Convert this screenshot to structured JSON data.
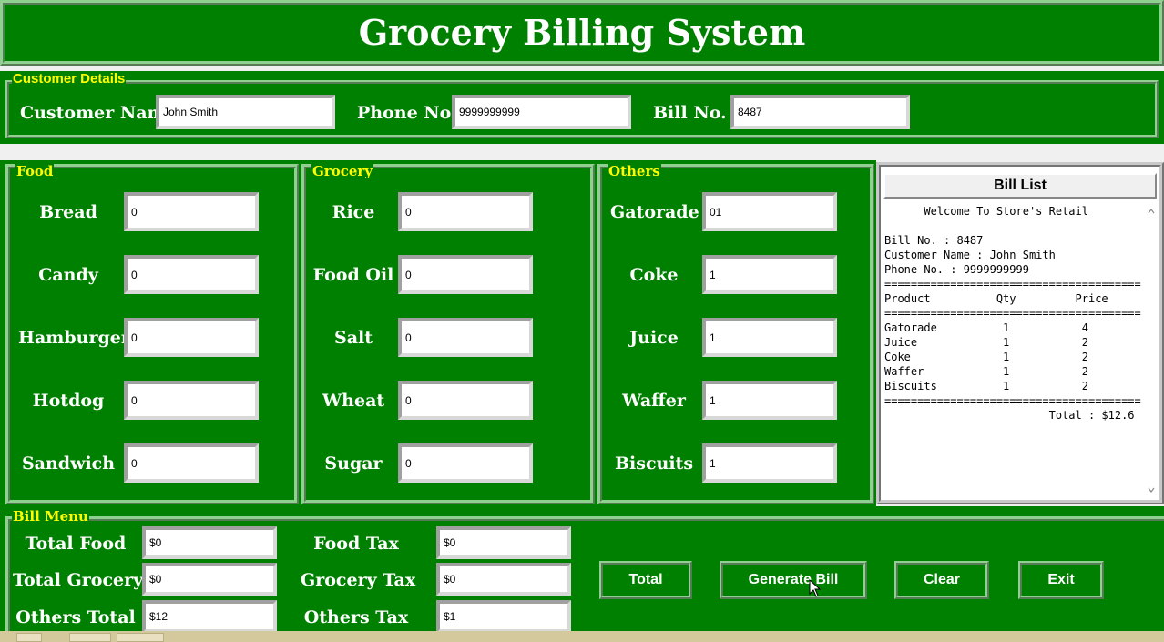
{
  "window": {
    "title": "Grocery Billing System"
  },
  "customer": {
    "frame_label": "Customer Details",
    "name_label": "Customer Name",
    "name_value": "John Smith",
    "phone_label": "Phone No",
    "phone_value": "9999999999",
    "bill_label": "Bill No.",
    "bill_value": "8487"
  },
  "food": {
    "frame_label": "Food",
    "items": [
      {
        "label": "Bread",
        "value": "0"
      },
      {
        "label": "Candy",
        "value": "0"
      },
      {
        "label": "Hamburger",
        "value": "0"
      },
      {
        "label": "Hotdog",
        "value": "0"
      },
      {
        "label": "Sandwich",
        "value": "0"
      }
    ]
  },
  "grocery": {
    "frame_label": "Grocery",
    "items": [
      {
        "label": "Rice",
        "value": "0"
      },
      {
        "label": "Food Oil",
        "value": "0"
      },
      {
        "label": "Salt",
        "value": "0"
      },
      {
        "label": "Wheat",
        "value": "0"
      },
      {
        "label": "Sugar",
        "value": "0"
      }
    ]
  },
  "others": {
    "frame_label": "Others",
    "items": [
      {
        "label": "Gatorade",
        "value": "01"
      },
      {
        "label": "Coke",
        "value": "1"
      },
      {
        "label": "Juice",
        "value": "1"
      },
      {
        "label": "Waffer",
        "value": "1"
      },
      {
        "label": "Biscuits",
        "value": "1"
      }
    ]
  },
  "bill": {
    "title": "Bill List",
    "lines": [
      "      Welcome To Store's Retail",
      "",
      "Bill No. : 8487",
      "Customer Name : John Smith",
      "Phone No. : 9999999999",
      "=======================================",
      "Product          Qty         Price",
      "=======================================",
      "Gatorade          1           4",
      "Juice             1           2",
      "Coke              1           2",
      "Waffer            1           2",
      "Biscuits          1           2",
      "=======================================",
      "                         Total : $12.6"
    ]
  },
  "bill_menu": {
    "frame_label": "Bill Menu",
    "total_food_label": "Total Food",
    "total_food_value": "$0",
    "total_grocery_label": "Total Grocery",
    "total_grocery_value": "$0",
    "others_total_label": "Others Total",
    "others_total_value": "$12",
    "food_tax_label": "Food Tax",
    "food_tax_value": "$0",
    "grocery_tax_label": "Grocery Tax",
    "grocery_tax_value": "$0",
    "others_tax_label": "Others Tax",
    "others_tax_value": "$1",
    "buttons": {
      "total": "Total",
      "generate": "Generate Bill",
      "clear": "Clear",
      "exit": "Exit"
    }
  },
  "colors": {
    "background": "#008000",
    "label_yellow": "#ffff00",
    "text_white": "#ffffff"
  },
  "icons": [
    "mouse-cursor-icon",
    "scroll-up-icon",
    "scroll-down-icon"
  ]
}
